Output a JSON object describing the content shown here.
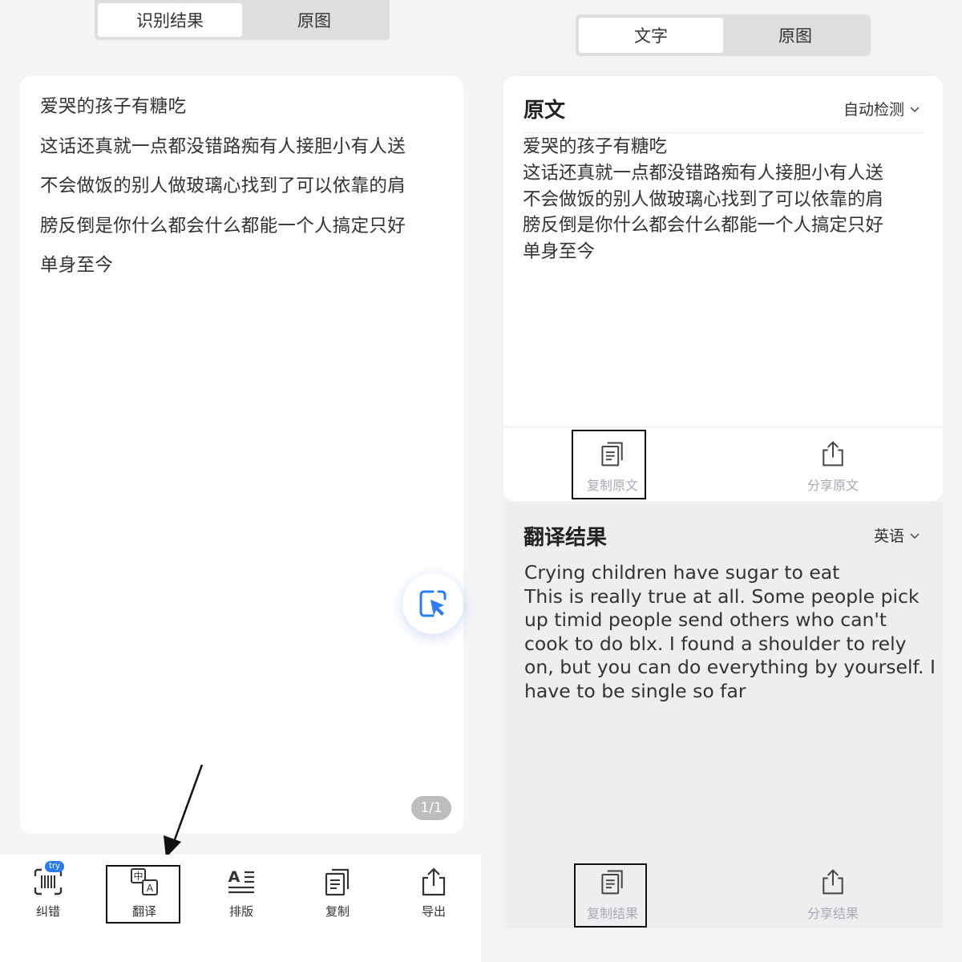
{
  "left": {
    "tabs": [
      {
        "label": "识别结果",
        "active": true
      },
      {
        "label": "原图",
        "active": false
      }
    ],
    "recognized_lines": [
      "爱哭的孩子有糖吃",
      "这话还真就一点都没错路痴有人接胆小有人送",
      "不会做饭的别人做玻璃心找到了可以依靠的肩",
      "膀反倒是你什么都会什么都能一个人搞定只好",
      "单身至今"
    ],
    "page_indicator": "1/1",
    "toolbar": {
      "badge": "try",
      "items": [
        {
          "label": "纠错",
          "icon": "scan-barcode-icon"
        },
        {
          "label": "翻译",
          "icon": "translate-icon"
        },
        {
          "label": "排版",
          "icon": "text-layout-icon"
        },
        {
          "label": "复制",
          "icon": "copy-icon"
        },
        {
          "label": "导出",
          "icon": "export-icon"
        }
      ]
    }
  },
  "right": {
    "tabs": [
      {
        "label": "文字",
        "active": true
      },
      {
        "label": "原图",
        "active": false
      }
    ],
    "original": {
      "title": "原文",
      "language": "自动检测",
      "lines": [
        "爱哭的孩子有糖吃",
        "这话还真就一点都没错路痴有人接胆小有人送",
        "不会做饭的别人做玻璃心找到了可以依靠的肩",
        "膀反倒是你什么都会什么都能一个人搞定只好",
        "单身至今"
      ],
      "copy_label": "复制原文",
      "share_label": "分享原文"
    },
    "translation": {
      "title": "翻译结果",
      "language": "英语",
      "lines": [
        "Crying children have sugar to eat",
        "This is really true at all. Some people pick",
        "up timid people send others who can't",
        "cook to do blx. I found a shoulder to rely",
        "on, but you can do everything by yourself. I",
        "have to be single so far"
      ],
      "copy_label": "复制结果",
      "share_label": "分享结果"
    }
  },
  "colors": {
    "accent": "#2a7cf0",
    "highlight_border": "#111111",
    "muted": "#a9a9b2"
  }
}
